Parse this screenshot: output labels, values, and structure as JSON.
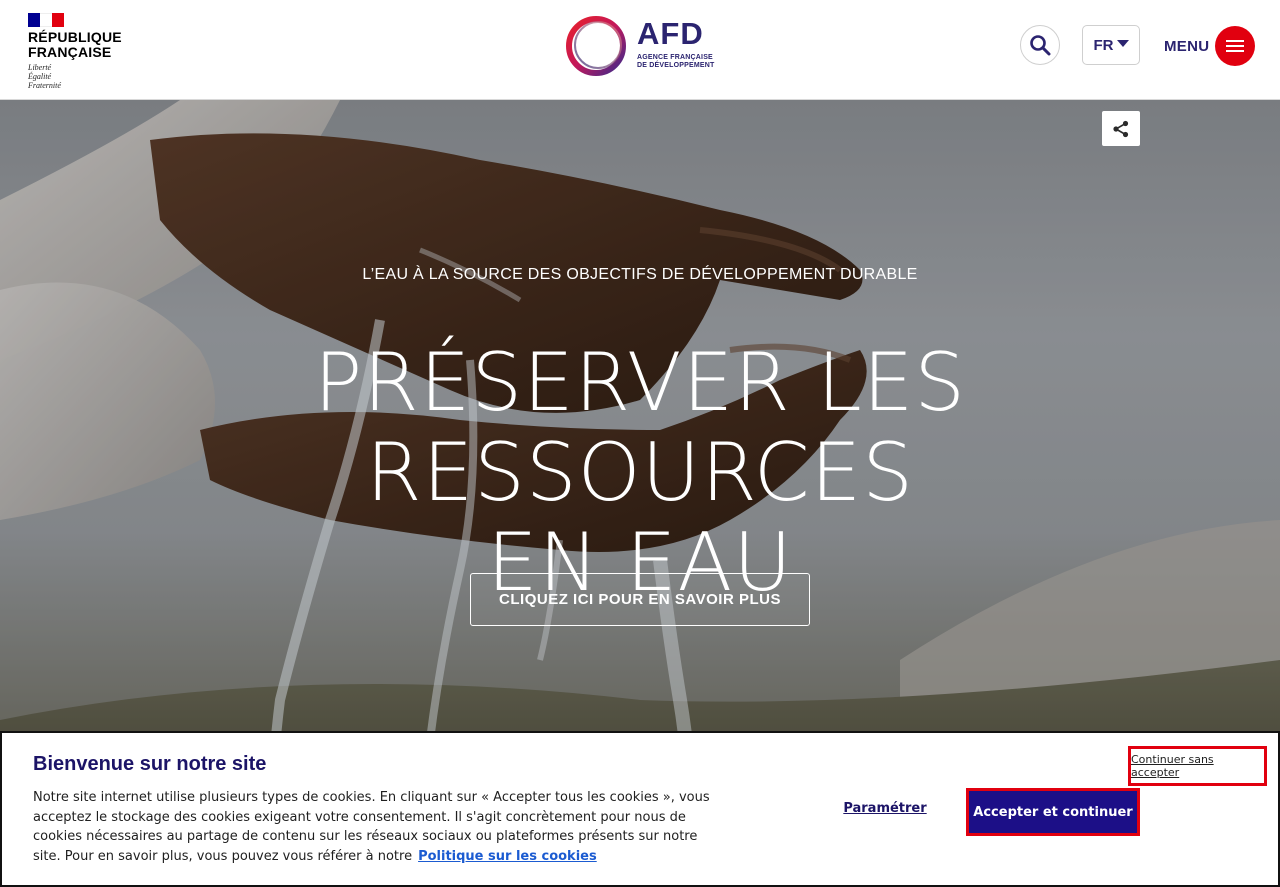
{
  "header": {
    "gov_logo": {
      "title": "RÉPUBLIQUE\nFRANÇAISE",
      "motto": "Liberté\nÉgalité\nFraternité",
      "flag_colors": [
        "#000091",
        "#ffffff",
        "#e1000f"
      ]
    },
    "afd_logo": {
      "word": "AFD",
      "subtitle": "AGENCE FRANÇAISE\nDE DÉVELOPPEMENT"
    },
    "search_icon": "search-icon",
    "language": {
      "selected": "FR"
    },
    "menu_label": "MENU"
  },
  "hero": {
    "share_icon": "share-icon",
    "kicker": "L’EAU À LA SOURCE DES OBJECTIFS DE DÉVELOPPEMENT DURABLE",
    "title": "PRÉSERVER LES RESSOURCES\nEN EAU",
    "cta_label": "CLIQUEZ ICI POUR EN SAVOIR PLUS"
  },
  "cookie_banner": {
    "title": "Bienvenue sur notre site",
    "text": "Notre site internet utilise plusieurs types de cookies. En cliquant sur « Accepter tous les cookies », vous acceptez le stockage des cookies exigeant votre consentement. Il s'agit concrètement pour nous de cookies nécessaires au partage de contenu sur les réseaux sociaux ou plateformes présents sur notre site. Pour en savoir plus, vous pouvez vous référer à notre",
    "policy_link": "Politique sur les cookies",
    "continue_label": "Continuer sans accepter",
    "settings_label": "Paramétrer",
    "accept_label": "Accepter et continuer"
  },
  "colors": {
    "brand_navy": "#1c1467",
    "accent_red": "#e1000f",
    "accept_bg": "#1c0f87",
    "link_blue": "#1b5bd1"
  }
}
